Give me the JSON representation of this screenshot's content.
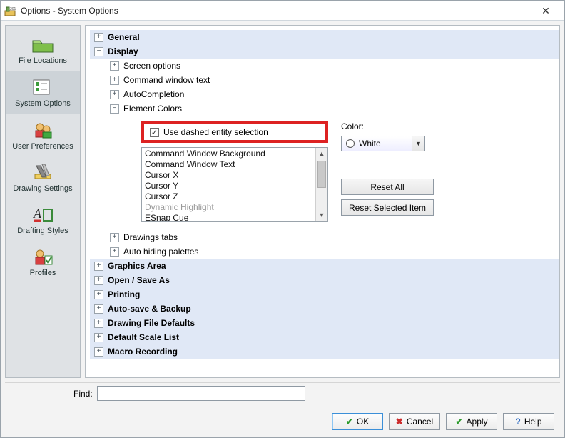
{
  "window": {
    "title": "Options - System Options"
  },
  "sidebar": {
    "items": [
      {
        "label": "File Locations"
      },
      {
        "label": "System Options"
      },
      {
        "label": "User Preferences"
      },
      {
        "label": "Drawing Settings"
      },
      {
        "label": "Drafting Styles"
      },
      {
        "label": "Profiles"
      }
    ]
  },
  "tree": {
    "general": "General",
    "display": "Display",
    "screen_options": "Screen options",
    "command_window_text": "Command window text",
    "autocompletion": "AutoCompletion",
    "element_colors": "Element Colors",
    "dashed_checkbox": "Use dashed entity selection",
    "list": [
      "Command Window Background",
      "Command Window Text",
      "Cursor X",
      "Cursor Y",
      "Cursor Z",
      "Dynamic Highlight",
      "ESnap Cue"
    ],
    "color_label": "Color:",
    "color_value": "White",
    "reset_all": "Reset All",
    "reset_selected": "Reset Selected Item",
    "drawings_tabs": "Drawings tabs",
    "auto_hiding": "Auto hiding palettes",
    "graphics_area": "Graphics Area",
    "open_save": "Open / Save As",
    "printing": "Printing",
    "autosave": "Auto-save & Backup",
    "drawing_defaults": "Drawing File Defaults",
    "default_scale": "Default Scale List",
    "macro_recording": "Macro Recording"
  },
  "find": {
    "label": "Find:",
    "value": ""
  },
  "buttons": {
    "ok": "OK",
    "cancel": "Cancel",
    "apply": "Apply",
    "help": "Help"
  }
}
